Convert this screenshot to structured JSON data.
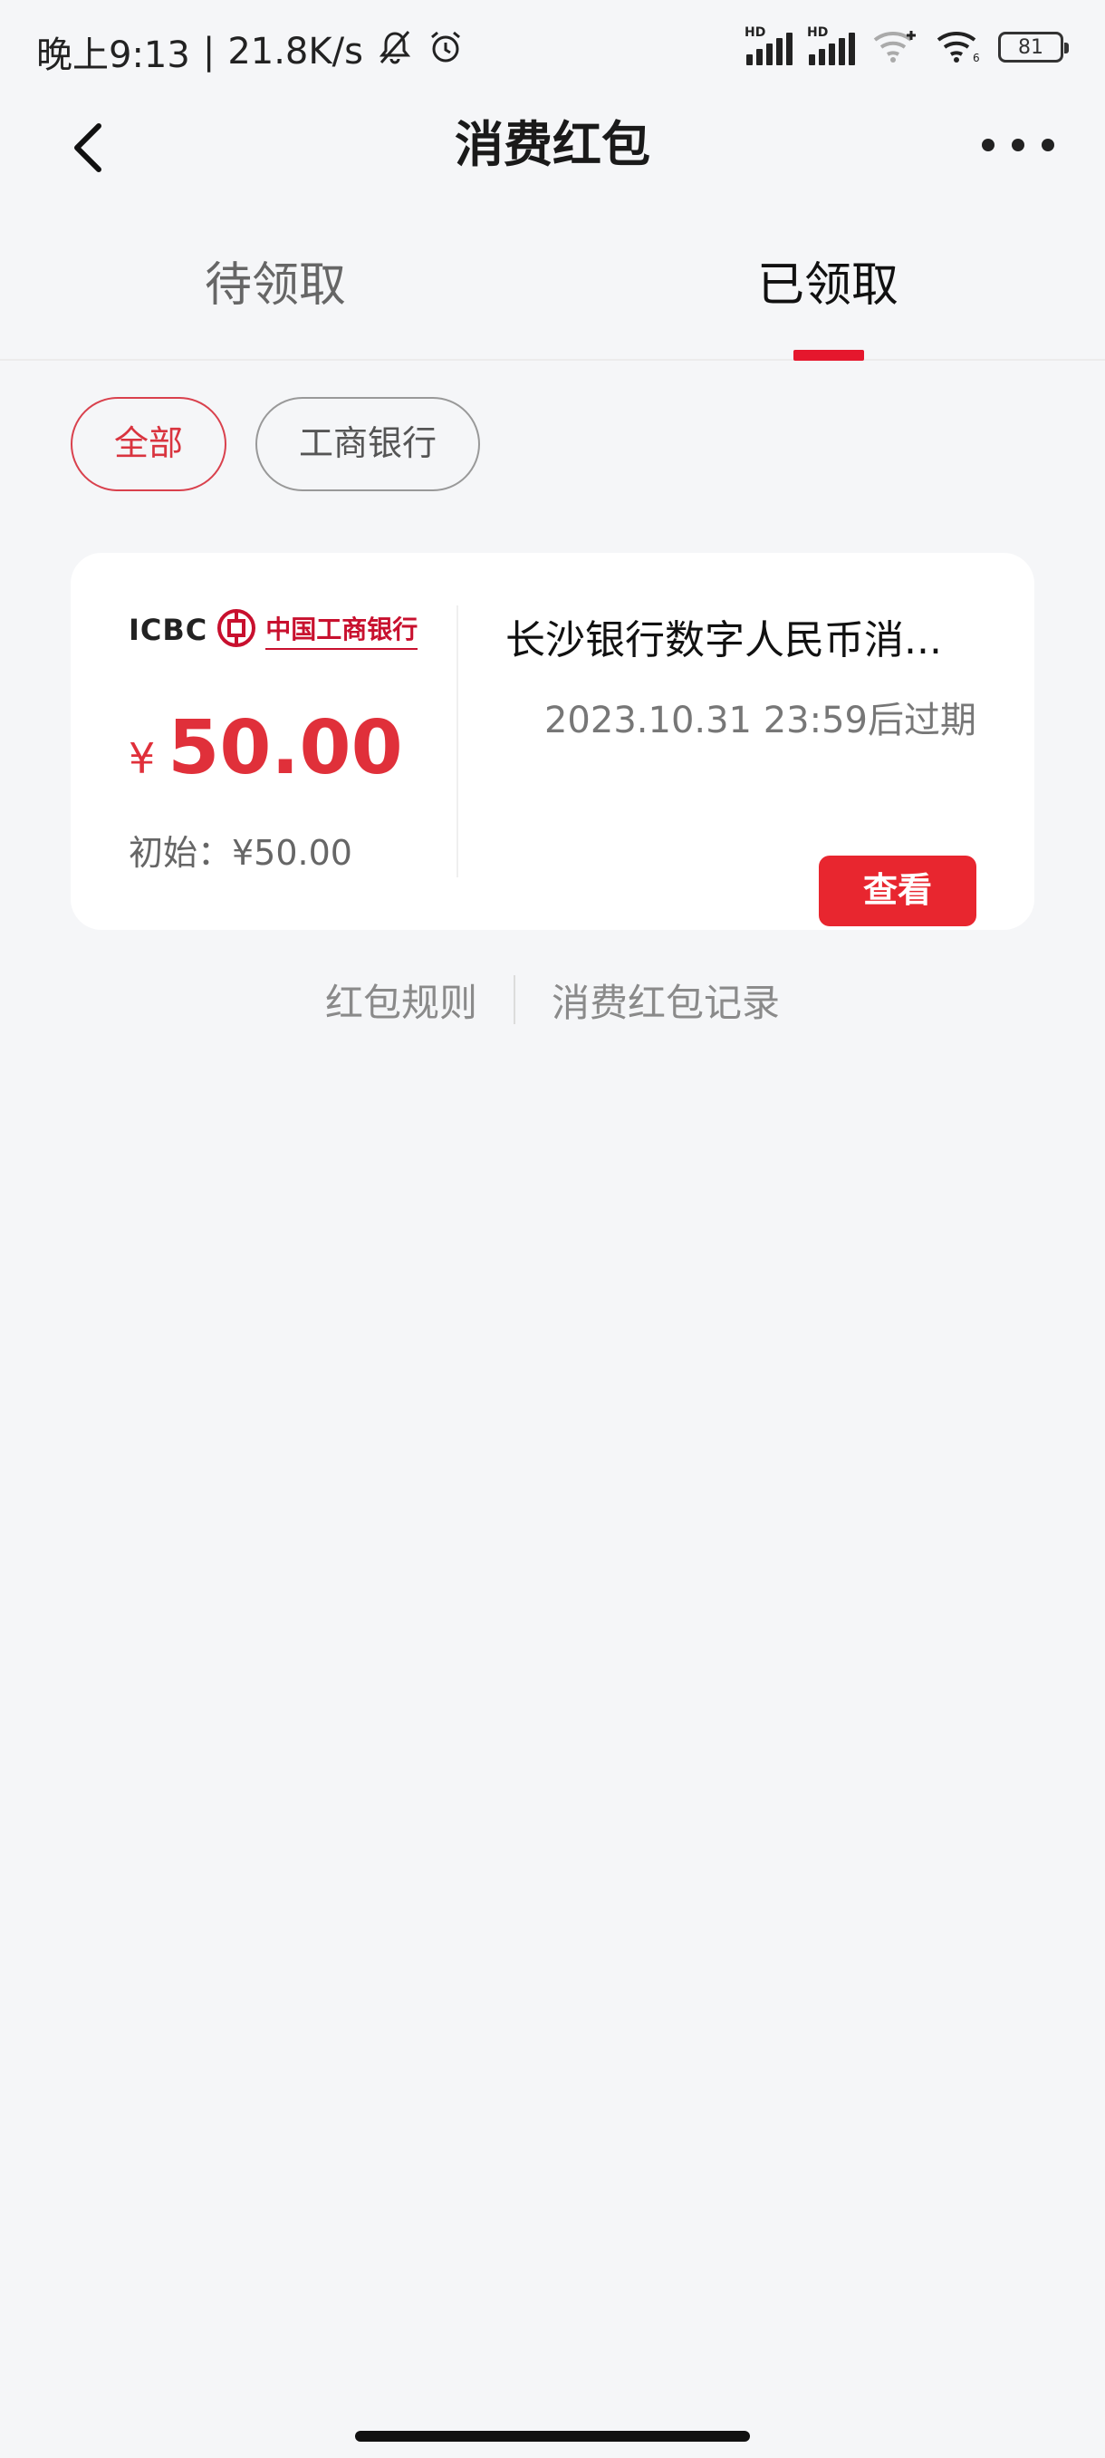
{
  "status_bar": {
    "time": "晚上9:13",
    "separator": "|",
    "network_speed": "21.8K/s",
    "signal_1_label": "HD",
    "signal_2_label": "HD",
    "battery": "81"
  },
  "header": {
    "title": "消费红包"
  },
  "tabs": [
    {
      "label": "待领取",
      "active": false
    },
    {
      "label": "已领取",
      "active": true
    }
  ],
  "filters": [
    {
      "label": "全部",
      "active": true
    },
    {
      "label": "工商银行",
      "active": false
    }
  ],
  "coupon": {
    "bank_logo_en": "ICBC",
    "bank_logo_cn": "中国工商银行",
    "currency": "¥",
    "amount": "50.00",
    "initial_label": "初始：¥50.00",
    "name": "长沙银行数字人民币消...",
    "expire_text": "2023.10.31 23:59后过期",
    "view_label": "查看"
  },
  "links": {
    "rules": "红包规则",
    "records": "消费红包记录"
  },
  "colors": {
    "accent": "#e5172d",
    "background": "#f5f6f8",
    "amount": "#e0303a"
  }
}
